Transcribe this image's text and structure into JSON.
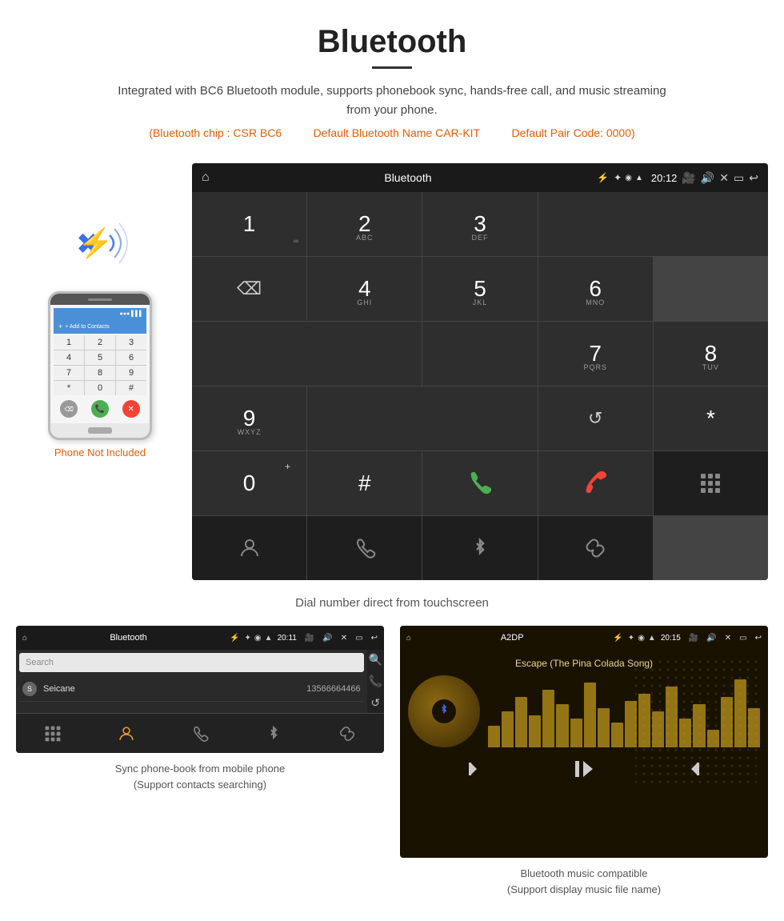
{
  "header": {
    "title": "Bluetooth",
    "description": "Integrated with BC6 Bluetooth module, supports phonebook sync, hands-free call, and music streaming from your phone.",
    "info_chip": "(Bluetooth chip : CSR BC6",
    "info_name": "Default Bluetooth Name CAR-KIT",
    "info_code": "Default Pair Code: 0000)",
    "divider": "———"
  },
  "car_display": {
    "status_bar": {
      "title": "Bluetooth",
      "time": "20:12"
    },
    "dialpad": {
      "keys": [
        {
          "num": "1",
          "sub": ""
        },
        {
          "num": "2",
          "sub": "ABC"
        },
        {
          "num": "3",
          "sub": "DEF"
        },
        {
          "num": "4",
          "sub": "GHI"
        },
        {
          "num": "5",
          "sub": "JKL"
        },
        {
          "num": "6",
          "sub": "MNO"
        },
        {
          "num": "7",
          "sub": "PQRS"
        },
        {
          "num": "8",
          "sub": "TUV"
        },
        {
          "num": "9",
          "sub": "WXYZ"
        },
        {
          "num": "*",
          "sub": ""
        },
        {
          "num": "0",
          "sub": "+"
        },
        {
          "num": "#",
          "sub": ""
        }
      ]
    },
    "caption": "Dial number direct from touchscreen"
  },
  "phone_aside": {
    "not_included_text": "Phone Not Included",
    "add_to_contacts": "+ Add to Contacts",
    "dial_keys": [
      "1",
      "2",
      "3",
      "4",
      "5",
      "6",
      "7",
      "8",
      "9",
      "*",
      "0",
      "#"
    ]
  },
  "phonebook_screen": {
    "status_title": "Bluetooth",
    "status_time": "20:11",
    "search_placeholder": "Search",
    "contacts": [
      {
        "letter": "S",
        "name": "Seicane",
        "number": "13566664466"
      }
    ],
    "caption_line1": "Sync phone-book from mobile phone",
    "caption_line2": "(Support contacts searching)"
  },
  "music_screen": {
    "status_title": "A2DP",
    "status_time": "20:15",
    "song_title": "Escape (The Pina Colada Song)",
    "caption_line1": "Bluetooth music compatible",
    "caption_line2": "(Support display music file name)"
  },
  "icons": {
    "home": "⌂",
    "bluetooth": "✦",
    "usb": "⚡",
    "back": "↩",
    "camera": "📷",
    "volume": "🔊",
    "close_x": "✕",
    "window": "▭",
    "backspace": "⌫",
    "refresh": "↺",
    "call_green": "📞",
    "call_end": "📵",
    "dialpad_icon": "⠿",
    "person_icon": "👤",
    "phone_icon": "📞",
    "bt_icon": "✦",
    "link_icon": "🔗",
    "search_icon": "🔍",
    "prev": "⏮",
    "play_pause": "⏯",
    "next": "⏭",
    "star": "★",
    "gps": "◉",
    "wifi": "▲",
    "cell": "▌"
  }
}
